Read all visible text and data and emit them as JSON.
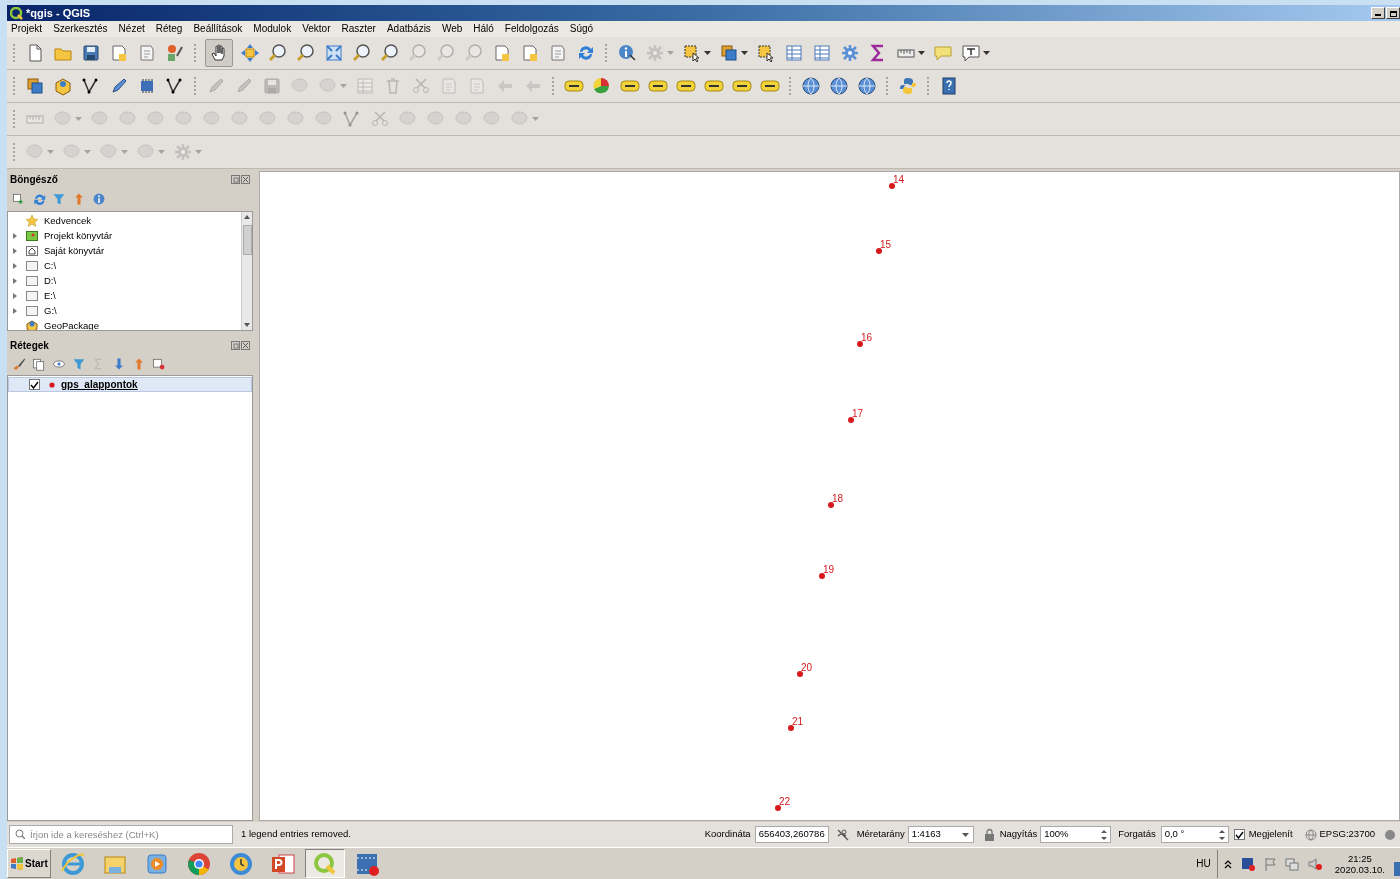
{
  "window": {
    "title": "*qgis - QGIS"
  },
  "menu": [
    "Projekt",
    "Szerkesztés",
    "Nézet",
    "Réteg",
    "Beállítások",
    "Modulok",
    "Vektor",
    "Raszter",
    "Adatbázis",
    "Web",
    "Háló",
    "Feldolgozás",
    "Súgó"
  ],
  "toolbars": [
    [
      {
        "kind": "file",
        "disabled": false,
        "pressed": false,
        "dropdown": false
      },
      {
        "kind": "folder",
        "disabled": false,
        "pressed": false,
        "dropdown": false
      },
      {
        "kind": "save",
        "disabled": false,
        "pressed": false,
        "dropdown": false
      },
      {
        "kind": "doc",
        "disabled": false,
        "pressed": false,
        "dropdown": false
      },
      {
        "kind": "page",
        "disabled": false,
        "pressed": false,
        "dropdown": false
      },
      {
        "kind": "style",
        "disabled": false,
        "pressed": false,
        "dropdown": false
      },
      {
        "kind": "sep"
      },
      {
        "kind": "hand",
        "disabled": false,
        "pressed": true,
        "dropdown": false
      },
      {
        "kind": "move",
        "disabled": false,
        "pressed": false,
        "dropdown": false
      },
      {
        "kind": "zoom",
        "disabled": false,
        "pressed": false,
        "dropdown": false
      },
      {
        "kind": "zoom",
        "disabled": false,
        "pressed": false,
        "dropdown": false
      },
      {
        "kind": "extent",
        "disabled": false,
        "pressed": false,
        "dropdown": false
      },
      {
        "kind": "zoom",
        "disabled": false,
        "pressed": false,
        "dropdown": false
      },
      {
        "kind": "zoom",
        "disabled": false,
        "pressed": false,
        "dropdown": false
      },
      {
        "kind": "zoom",
        "disabled": true,
        "pressed": false,
        "dropdown": false
      },
      {
        "kind": "zoom",
        "disabled": true,
        "pressed": false,
        "dropdown": false
      },
      {
        "kind": "zoom",
        "disabled": true,
        "pressed": false,
        "dropdown": false
      },
      {
        "kind": "doc",
        "disabled": false,
        "pressed": false,
        "dropdown": false
      },
      {
        "kind": "doc",
        "disabled": false,
        "pressed": false,
        "dropdown": false
      },
      {
        "kind": "page",
        "disabled": false,
        "pressed": false,
        "dropdown": false
      },
      {
        "kind": "refresh",
        "disabled": false,
        "pressed": false,
        "dropdown": false
      },
      {
        "kind": "sep"
      },
      {
        "kind": "info",
        "disabled": false,
        "pressed": false,
        "dropdown": false
      },
      {
        "kind": "gear",
        "disabled": true,
        "pressed": false,
        "dropdown": true
      },
      {
        "kind": "select",
        "disabled": false,
        "pressed": false,
        "dropdown": true
      },
      {
        "kind": "layers",
        "disabled": false,
        "pressed": false,
        "dropdown": true
      },
      {
        "kind": "select",
        "disabled": false,
        "pressed": false,
        "dropdown": false
      },
      {
        "kind": "table",
        "disabled": false,
        "pressed": false,
        "dropdown": false
      },
      {
        "kind": "table",
        "disabled": false,
        "pressed": false,
        "dropdown": false
      },
      {
        "kind": "gear",
        "disabled": false,
        "pressed": false,
        "dropdown": false
      },
      {
        "kind": "sigma",
        "disabled": false,
        "pressed": false,
        "dropdown": false
      },
      {
        "kind": "ruler",
        "disabled": false,
        "pressed": false,
        "dropdown": true
      },
      {
        "kind": "speech",
        "disabled": false,
        "pressed": false,
        "dropdown": false
      },
      {
        "kind": "bubble",
        "disabled": false,
        "pressed": false,
        "dropdown": true
      }
    ],
    [
      {
        "kind": "layers",
        "disabled": false,
        "pressed": false,
        "dropdown": false
      },
      {
        "kind": "box",
        "disabled": false,
        "pressed": false,
        "dropdown": false
      },
      {
        "kind": "vertex",
        "disabled": false,
        "pressed": false,
        "dropdown": false
      },
      {
        "kind": "pencil",
        "disabled": false,
        "pressed": false,
        "dropdown": false
      },
      {
        "kind": "chip",
        "disabled": false,
        "pressed": false,
        "dropdown": false
      },
      {
        "kind": "vertex",
        "disabled": false,
        "pressed": false,
        "dropdown": false
      },
      {
        "kind": "sep"
      },
      {
        "kind": "pencil",
        "disabled": true,
        "pressed": false,
        "dropdown": false
      },
      {
        "kind": "pencil",
        "disabled": true,
        "pressed": false,
        "dropdown": false
      },
      {
        "kind": "save",
        "disabled": true,
        "pressed": false,
        "dropdown": false
      },
      {
        "kind": "shape",
        "disabled": true,
        "pressed": false,
        "dropdown": false
      },
      {
        "kind": "shape",
        "disabled": true,
        "pressed": false,
        "dropdown": true
      },
      {
        "kind": "table",
        "disabled": true,
        "pressed": false,
        "dropdown": false
      },
      {
        "kind": "trash",
        "disabled": true,
        "pressed": false,
        "dropdown": false
      },
      {
        "kind": "scissors",
        "disabled": true,
        "pressed": false,
        "dropdown": false
      },
      {
        "kind": "page",
        "disabled": true,
        "pressed": false,
        "dropdown": false
      },
      {
        "kind": "page",
        "disabled": true,
        "pressed": false,
        "dropdown": false
      },
      {
        "kind": "undo",
        "disabled": true,
        "pressed": false,
        "dropdown": false
      },
      {
        "kind": "undo",
        "disabled": true,
        "pressed": false,
        "dropdown": false
      },
      {
        "kind": "sep"
      },
      {
        "kind": "label",
        "disabled": false,
        "pressed": false,
        "dropdown": false
      },
      {
        "kind": "pie",
        "disabled": false,
        "pressed": false,
        "dropdown": false
      },
      {
        "kind": "label",
        "disabled": false,
        "pressed": false,
        "dropdown": false
      },
      {
        "kind": "label",
        "disabled": false,
        "pressed": false,
        "dropdown": false
      },
      {
        "kind": "label",
        "disabled": false,
        "pressed": false,
        "dropdown": false
      },
      {
        "kind": "label",
        "disabled": false,
        "pressed": false,
        "dropdown": false
      },
      {
        "kind": "label",
        "disabled": false,
        "pressed": false,
        "dropdown": false
      },
      {
        "kind": "label",
        "disabled": false,
        "pressed": false,
        "dropdown": false
      },
      {
        "kind": "sep"
      },
      {
        "kind": "globe",
        "disabled": false,
        "pressed": false,
        "dropdown": false
      },
      {
        "kind": "globe",
        "disabled": false,
        "pressed": false,
        "dropdown": false
      },
      {
        "kind": "globe",
        "disabled": false,
        "pressed": false,
        "dropdown": false
      },
      {
        "kind": "sep"
      },
      {
        "kind": "python",
        "disabled": false,
        "pressed": false,
        "dropdown": false
      },
      {
        "kind": "sep"
      },
      {
        "kind": "help",
        "disabled": false,
        "pressed": false,
        "dropdown": false
      }
    ],
    [
      {
        "kind": "ruler",
        "disabled": true,
        "pressed": false,
        "dropdown": false
      },
      {
        "kind": "shape",
        "disabled": true,
        "pressed": false,
        "dropdown": true
      },
      {
        "kind": "shape",
        "disabled": true,
        "pressed": false,
        "dropdown": false
      },
      {
        "kind": "shape",
        "disabled": true,
        "pressed": false,
        "dropdown": false
      },
      {
        "kind": "shape",
        "disabled": true,
        "pressed": false,
        "dropdown": false
      },
      {
        "kind": "shape",
        "disabled": true,
        "pressed": false,
        "dropdown": false
      },
      {
        "kind": "shape",
        "disabled": true,
        "pressed": false,
        "dropdown": false
      },
      {
        "kind": "shape",
        "disabled": true,
        "pressed": false,
        "dropdown": false
      },
      {
        "kind": "shape",
        "disabled": true,
        "pressed": false,
        "dropdown": false
      },
      {
        "kind": "shape",
        "disabled": true,
        "pressed": false,
        "dropdown": false
      },
      {
        "kind": "shape",
        "disabled": true,
        "pressed": false,
        "dropdown": false
      },
      {
        "kind": "vertex",
        "disabled": true,
        "pressed": false,
        "dropdown": false
      },
      {
        "kind": "scissors",
        "disabled": true,
        "pressed": false,
        "dropdown": false
      },
      {
        "kind": "shape",
        "disabled": true,
        "pressed": false,
        "dropdown": false
      },
      {
        "kind": "shape",
        "disabled": true,
        "pressed": false,
        "dropdown": false
      },
      {
        "kind": "shape",
        "disabled": true,
        "pressed": false,
        "dropdown": false
      },
      {
        "kind": "shape",
        "disabled": true,
        "pressed": false,
        "dropdown": false
      },
      {
        "kind": "shape",
        "disabled": true,
        "pressed": false,
        "dropdown": true
      }
    ],
    [
      {
        "kind": "shape",
        "disabled": true,
        "pressed": false,
        "dropdown": true
      },
      {
        "kind": "shape",
        "disabled": true,
        "pressed": false,
        "dropdown": true
      },
      {
        "kind": "shape",
        "disabled": true,
        "pressed": false,
        "dropdown": true
      },
      {
        "kind": "shape",
        "disabled": true,
        "pressed": false,
        "dropdown": true
      },
      {
        "kind": "gear",
        "disabled": true,
        "pressed": false,
        "dropdown": true
      }
    ]
  ],
  "browser": {
    "title": "Böngésző",
    "items": [
      {
        "label": "Kedvencek",
        "kind": "star",
        "expandable": false
      },
      {
        "label": "Projekt könyvtár",
        "kind": "project",
        "expandable": true
      },
      {
        "label": "Saját könyvtár",
        "kind": "home",
        "expandable": true
      },
      {
        "label": "C:\\",
        "kind": "folder",
        "expandable": true
      },
      {
        "label": "D:\\",
        "kind": "folder",
        "expandable": true
      },
      {
        "label": "E:\\",
        "kind": "folder",
        "expandable": true
      },
      {
        "label": "G:\\",
        "kind": "folder",
        "expandable": true
      },
      {
        "label": "GeoPackage",
        "kind": "geopackage",
        "expandable": false
      }
    ]
  },
  "layers_panel": {
    "title": "Rétegek",
    "layers": [
      {
        "name": "gps_alappontok",
        "visible": true,
        "selected": true,
        "color": "#d7191c"
      }
    ]
  },
  "map": {
    "points": [
      {
        "label": "14"
      },
      {
        "label": "15"
      },
      {
        "label": "16"
      },
      {
        "label": "17"
      },
      {
        "label": "18"
      },
      {
        "label": "19"
      },
      {
        "label": "20"
      },
      {
        "label": "21"
      },
      {
        "label": "22"
      }
    ]
  },
  "status_bar": {
    "search_placeholder": "Írjon ide a kereséshez (Ctrl+K)",
    "message": "1 legend entries removed.",
    "coordinate_label": "Koordináta",
    "coordinate": "656403,260786",
    "scale_label": "Méretarány",
    "scale": "1:4163",
    "magnifier_label": "Nagyítás",
    "magnifier": "100%",
    "rotation_label": "Forgatás",
    "rotation": "0,0 °",
    "render_label": "Megjelenít",
    "render": true,
    "crs": "EPSG:23700"
  },
  "taskbar": {
    "start": "Start",
    "apps": [
      {
        "kind": "ie",
        "selected": false
      },
      {
        "kind": "explorer",
        "selected": false
      },
      {
        "kind": "media",
        "selected": false
      },
      {
        "kind": "chrome",
        "selected": false
      },
      {
        "kind": "clock",
        "selected": false
      },
      {
        "kind": "powerpoint",
        "selected": false
      },
      {
        "kind": "qgis",
        "selected": true
      },
      {
        "kind": "video",
        "selected": false
      }
    ],
    "language": "HU",
    "time": "21:25",
    "date": "2020.03.10."
  }
}
